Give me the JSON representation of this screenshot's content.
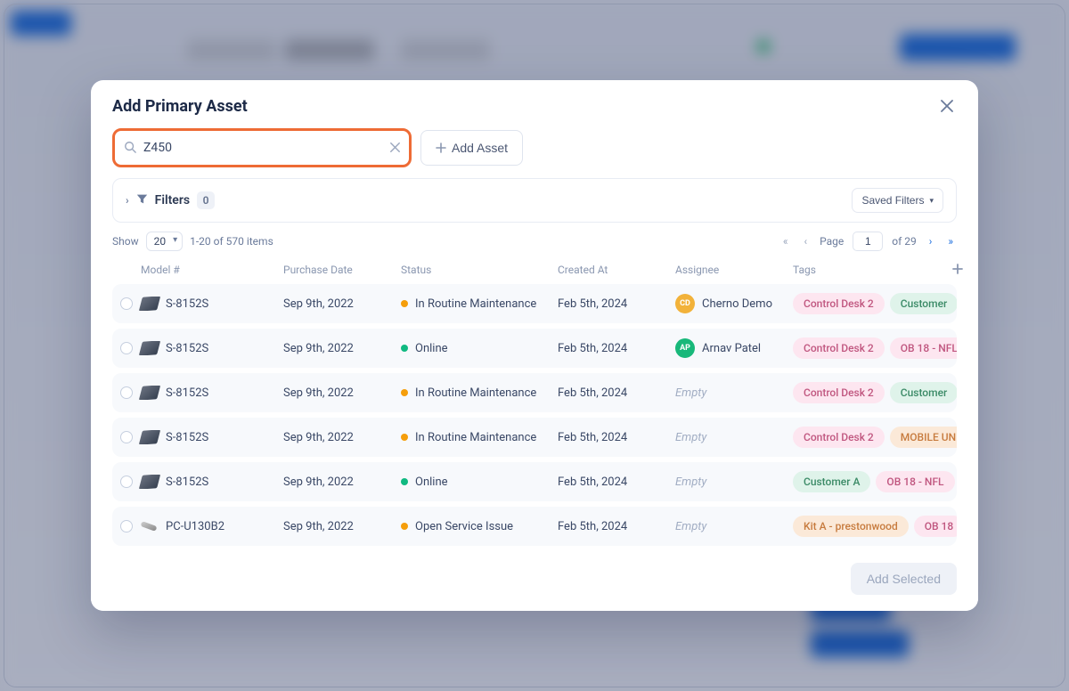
{
  "modal": {
    "title": "Add Primary Asset",
    "search_value": "Z450",
    "add_asset_label": "Add Asset",
    "filters_label": "Filters",
    "filters_count": "0",
    "saved_filters_label": "Saved Filters",
    "add_selected_label": "Add Selected"
  },
  "pagination": {
    "show_label": "Show",
    "page_size": "20",
    "range_text": "1-20 of 570 items",
    "page_label": "Page",
    "page_current": "1",
    "of_text": "of 29"
  },
  "columns": {
    "model": "Model #",
    "purchase_date": "Purchase Date",
    "status": "Status",
    "created_at": "Created At",
    "assignee": "Assignee",
    "tags": "Tags"
  },
  "status_colors": {
    "In Routine Maintenance": "#f59e0b",
    "Online": "#10b981",
    "Open Service Issue": "#f59e0b"
  },
  "tag_styles": {
    "Control Desk 2": {
      "bg": "#fde6f0",
      "fg": "#c0567f"
    },
    "Customer": {
      "bg": "#dff3ea",
      "fg": "#3a8a66"
    },
    "Customer A": {
      "bg": "#dff3ea",
      "fg": "#3a8a66"
    },
    "OB 18 - NFL": {
      "bg": "#fde6f0",
      "fg": "#c0567f"
    },
    "OB 18": {
      "bg": "#fde6f0",
      "fg": "#c0567f"
    },
    "MOBILE UN": {
      "bg": "#fbe9d8",
      "fg": "#c77b3e"
    },
    "Kit A - prestonwood": {
      "bg": "#fbe9d8",
      "fg": "#c77b3e"
    }
  },
  "rows": [
    {
      "icon": "device",
      "model": "S-8152S",
      "purchase": "Sep 9th, 2022",
      "status": "In Routine Maintenance",
      "created": "Feb 5th, 2024",
      "assignee": {
        "name": "Cherno Demo",
        "initials": "CD",
        "color": "#f2b23a"
      },
      "tags": [
        "Control Desk 2",
        "Customer"
      ]
    },
    {
      "icon": "device",
      "model": "S-8152S",
      "purchase": "Sep 9th, 2022",
      "status": "Online",
      "created": "Feb 5th, 2024",
      "assignee": {
        "name": "Arnav Patel",
        "initials": "AP",
        "color": "#18b87a"
      },
      "tags": [
        "Control Desk 2",
        "OB 18 - NFL"
      ]
    },
    {
      "icon": "device",
      "model": "S-8152S",
      "purchase": "Sep 9th, 2022",
      "status": "In Routine Maintenance",
      "created": "Feb 5th, 2024",
      "assignee": null,
      "tags": [
        "Control Desk 2",
        "Customer"
      ]
    },
    {
      "icon": "device",
      "model": "S-8152S",
      "purchase": "Sep 9th, 2022",
      "status": "In Routine Maintenance",
      "created": "Feb 5th, 2024",
      "assignee": null,
      "tags": [
        "Control Desk 2",
        "MOBILE UN"
      ]
    },
    {
      "icon": "device",
      "model": "S-8152S",
      "purchase": "Sep 9th, 2022",
      "status": "Online",
      "created": "Feb 5th, 2024",
      "assignee": null,
      "tags": [
        "Customer A",
        "OB 18 - NFL"
      ]
    },
    {
      "icon": "cable",
      "model": "PC-U130B2",
      "purchase": "Sep 9th, 2022",
      "status": "Open Service Issue",
      "created": "Feb 5th, 2024",
      "assignee": null,
      "tags": [
        "Kit A - prestonwood",
        "OB 18"
      ]
    }
  ],
  "empty_label": "Empty"
}
